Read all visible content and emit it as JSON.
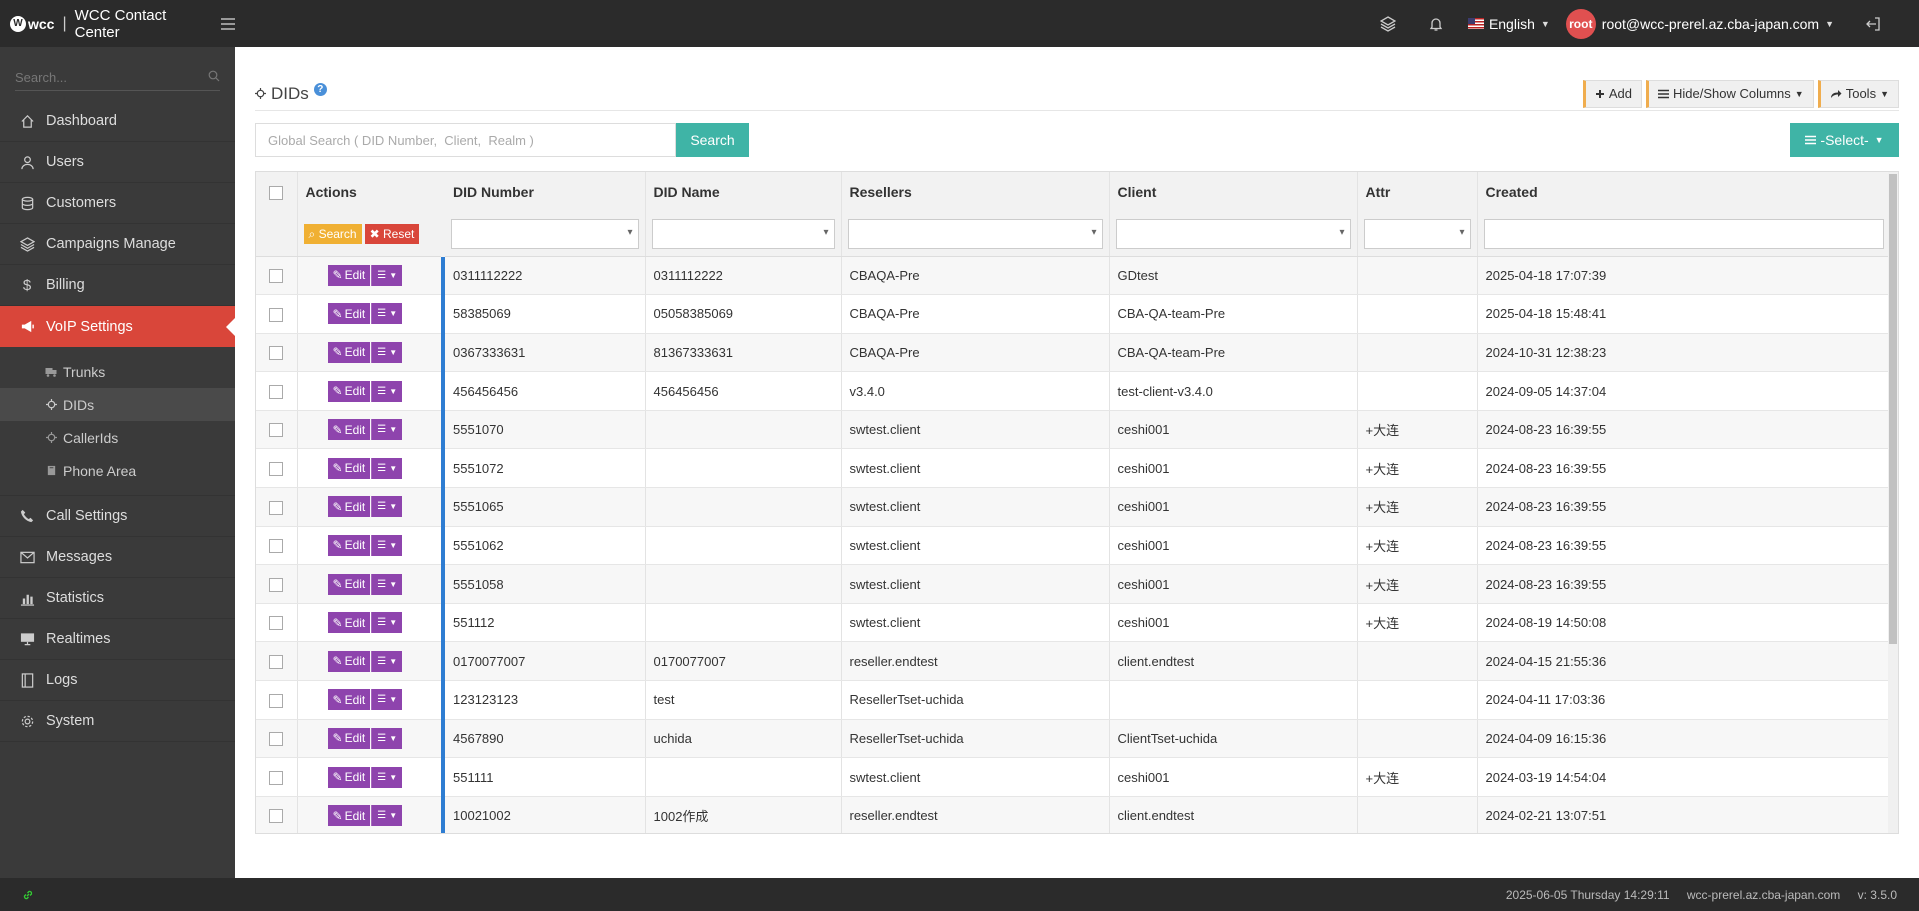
{
  "app": {
    "logo_text": "wcc",
    "title": "WCC Contact Center"
  },
  "topbar": {
    "language": "English",
    "avatar_text": "root",
    "user": "root@wcc-prerel.az.cba-japan.com"
  },
  "sidebar": {
    "search_placeholder": "Search...",
    "items": [
      {
        "label": "Dashboard",
        "icon": "home-icon"
      },
      {
        "label": "Users",
        "icon": "user-icon"
      },
      {
        "label": "Customers",
        "icon": "database-icon"
      },
      {
        "label": "Campaigns Manage",
        "icon": "layers-icon"
      },
      {
        "label": "Billing",
        "icon": "dollar-icon"
      },
      {
        "label": "VoIP Settings",
        "icon": "megaphone-icon",
        "active": true
      }
    ],
    "sub_items": [
      {
        "label": "Trunks",
        "icon": "truck-icon"
      },
      {
        "label": "DIDs",
        "icon": "crosshair-icon",
        "current": true
      },
      {
        "label": "CallerIds",
        "icon": "crosshair-icon"
      },
      {
        "label": "Phone Area",
        "icon": "book-icon"
      }
    ],
    "items_after": [
      {
        "label": "Call Settings",
        "icon": "phone-icon"
      },
      {
        "label": "Messages",
        "icon": "envelope-icon"
      },
      {
        "label": "Statistics",
        "icon": "bar-chart-icon"
      },
      {
        "label": "Realtimes",
        "icon": "monitor-icon"
      },
      {
        "label": "Logs",
        "icon": "file-icon"
      },
      {
        "label": "System",
        "icon": "gear-icon"
      }
    ]
  },
  "page": {
    "title": "DIDs",
    "help": "?",
    "buttons": {
      "add": "Add",
      "hide_show": "Hide/Show Columns",
      "tools": "Tools"
    },
    "search_placeholder": "Global Search ( DID Number,  Client,  Realm )",
    "search_button": "Search",
    "select_button": "-Select-"
  },
  "table": {
    "headers": [
      "Actions",
      "DID Number",
      "DID Name",
      "Resellers",
      "Client",
      "Attr",
      "Created"
    ],
    "filter_search": "Search",
    "filter_reset": "Reset",
    "edit_label": "Edit",
    "rows": [
      [
        "0311112222",
        "0311112222",
        "CBAQA-Pre",
        "GDtest",
        "",
        "2025-04-18 17:07:39"
      ],
      [
        "58385069",
        "05058385069",
        "CBAQA-Pre",
        "CBA-QA-team-Pre",
        "",
        "2025-04-18 15:48:41"
      ],
      [
        "0367333631",
        "81367333631",
        "CBAQA-Pre",
        "CBA-QA-team-Pre",
        "",
        "2024-10-31 12:38:23"
      ],
      [
        "456456456",
        "456456456",
        "v3.4.0",
        "test-client-v3.4.0",
        "",
        "2024-09-05 14:37:04"
      ],
      [
        "5551070",
        "",
        "swtest.client",
        "ceshi001",
        "+大连",
        "2024-08-23 16:39:55"
      ],
      [
        "5551072",
        "",
        "swtest.client",
        "ceshi001",
        "+大连",
        "2024-08-23 16:39:55"
      ],
      [
        "5551065",
        "",
        "swtest.client",
        "ceshi001",
        "+大连",
        "2024-08-23 16:39:55"
      ],
      [
        "5551062",
        "",
        "swtest.client",
        "ceshi001",
        "+大连",
        "2024-08-23 16:39:55"
      ],
      [
        "5551058",
        "",
        "swtest.client",
        "ceshi001",
        "+大连",
        "2024-08-23 16:39:55"
      ],
      [
        "551112",
        "",
        "swtest.client",
        "ceshi001",
        "+大连",
        "2024-08-19 14:50:08"
      ],
      [
        "0170077007",
        "0170077007",
        "reseller.endtest",
        "client.endtest",
        "",
        "2024-04-15 21:55:36"
      ],
      [
        "123123123",
        "test",
        "ResellerTset-uchida",
        "",
        "",
        "2024-04-11 17:03:36"
      ],
      [
        "4567890",
        "uchida",
        "ResellerTset-uchida",
        "ClientTset-uchida",
        "",
        "2024-04-09 16:15:36"
      ],
      [
        "551111",
        "",
        "swtest.client",
        "ceshi001",
        "+大连",
        "2024-03-19 14:54:04"
      ],
      [
        "10021002",
        "1002作成",
        "reseller.endtest",
        "client.endtest",
        "",
        "2024-02-21 13:07:51"
      ]
    ]
  },
  "footer": {
    "datetime": "2025-06-05 Thursday 14:29:11",
    "host": "wcc-prerel.az.cba-japan.com",
    "version": "v: 3.5.0"
  },
  "colors": {
    "accent_red": "#d9463a",
    "teal": "#3fb4a6",
    "purple": "#8e44ad",
    "sidebar": "#3a3a3a",
    "topbar": "#2b2b2b"
  }
}
